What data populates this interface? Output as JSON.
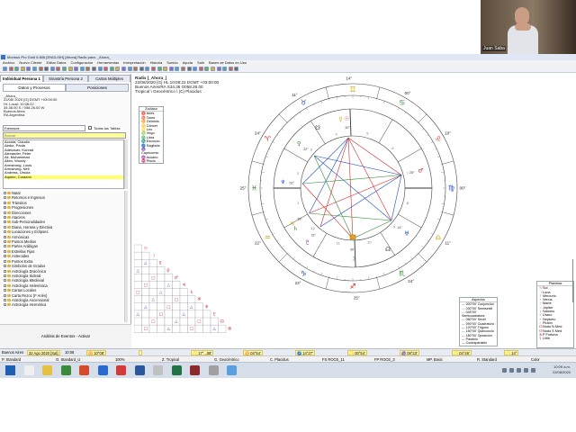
{
  "window": {
    "title": "Morinus Pro Gold 6.806 [ENGLISH] [Ahora] Radix para: _Ahora_"
  },
  "menu": [
    "Archivo",
    "Nuevo Cliente",
    "Editar Datos",
    "Configuración",
    "Herramientas",
    "Interpretación",
    "Historia",
    "Sonido",
    "Ayuda",
    "Salir",
    "Bases de Datos en Uso"
  ],
  "meeting": {
    "participant_name": "Juan Saba"
  },
  "left_panel": {
    "tabs_top": [
      "Individual Persona 1",
      "Sinastría Persona 2",
      "Cartas Múltiples"
    ],
    "tabs_sub": [
      "Datos y Procesos",
      "Posiciones"
    ],
    "person": {
      "line1": "_Ahora_",
      "line2": "22/08/ 2020 [G]  DGMT +03:00:00",
      "line3": "Hr. Local: 10:08:22",
      "line4": "34.36.00 S / 058.26.00 W",
      "line5": "Buenos Aires",
      "line6": "RA Argentina"
    },
    "file_select": "Famosos",
    "all_charts_label": "Todas las Tablas",
    "search_placeholder": "Buscar",
    "names": [
      "Acosta, Claudio",
      "Abdur, Paula",
      "Adenauer, Konrad",
      "Alexander, Peter",
      "Ali, Muhammad",
      "Allen, Woody",
      "Armstrong, Louis",
      "Armstrong, Neil",
      "Andress, Ursula",
      "Aquino, Corazón"
    ],
    "tree": [
      "Natal",
      "Retornos e Ingresos",
      "Tránsitos",
      "Progresiones",
      "Direcciones",
      "Atacires",
      "Sub-Personalidades",
      "Diana, Horaria y Electiva",
      "Lunaciones y Eclipses",
      "Armónicas",
      "Puntos Medios",
      "Partes Arábigas",
      "Estrellas Fijas",
      "Asteroides",
      "Puntos Extra",
      "Símbolos de Grados",
      "Astrología Dracónica",
      "Astrología Sideral",
      "Astrología Medieval",
      "Astrología Helenística",
      "Cartas Locales",
      "Carta Rezoc (F Ariés)",
      "Astrología Ascensional",
      "Astrología Hermética"
    ],
    "events_label": "Análisis de Eventos - Activar"
  },
  "chart_header": {
    "title": "Radix [_Ahora_]",
    "line2": "22/08/2020 [G]  HL 10:08:22  DGMT +03:00:00",
    "line3": "Buenos Aires/RA   S34.36  O058.26.00",
    "line4": "Tropical \\ Geocéntrico \\ (C) Placidus"
  },
  "zodiac_list": {
    "header": "Zodíaco",
    "signs": [
      "Aries",
      "Tauro",
      "Géminis",
      "Cáncer",
      "Leo",
      "Virgo",
      "Libra",
      "Escorpio",
      "Sagitario",
      "Capricornio",
      "Acuario",
      "Piscis"
    ]
  },
  "wheel": {
    "cusp_labels": [
      "25°",
      "24°",
      "11°",
      "14°",
      "00°",
      "10°",
      "00°",
      "11°",
      "24°",
      "25°",
      "23°",
      "22°"
    ],
    "inner_labels": [
      "30°",
      "25°",
      "22°",
      "29°",
      "14°",
      "00°",
      "02°",
      "22°"
    ],
    "house_numbers": [
      "1",
      "2",
      "3",
      "4",
      "5",
      "6",
      "7",
      "8",
      "9",
      "10",
      "11",
      "12"
    ],
    "sign_glyphs": [
      "♌",
      "♋",
      "♊",
      "♉",
      "♈",
      "♓",
      "♒",
      "♑",
      "♐",
      "♏",
      "♎",
      "♍"
    ],
    "colors": {
      "fire": "#d62828",
      "earth": "#2f8a2f",
      "air": "#c8a800",
      "water": "#1f4fbf"
    }
  },
  "aspect_legend": {
    "header": "Aspectos",
    "items": [
      "000°00' Conjunción",
      "030°00' Semisextil",
      "045°00' Semicuadratura",
      "060°00' Sextil",
      "090°00' Cuadratura",
      "120°00' Trígono",
      "150°00' Quincuncio",
      "180°00' Oposición",
      "Paralelo",
      "Contraparalelo"
    ]
  },
  "planet_legend": {
    "header": "Planetas",
    "items": [
      "Sol",
      "Luna",
      "Mercurio",
      "Venus",
      "Marte",
      "Júpiter",
      "Saturno",
      "Urano",
      "Neptuno",
      "Plutón",
      "Nodo N Med",
      "Nodo S Med",
      "P Fortuna",
      "Lilith"
    ]
  },
  "status_bar": {
    "location": "Buenos Aires",
    "date": "22 Ago 2020 [Sat]",
    "time": "10:08",
    "cells": [
      "♊ 10°08'",
      "",
      "♌ 17°...08'",
      "♊ 04°54'",
      "♐ 14°27'",
      "♌ 00°54'",
      "♑ 08°23'",
      "♌ 04°46'",
      "♌ 14°"
    ],
    "row2": [
      "P. Standard",
      "O. Standard_U",
      "100%",
      "Z. Tropical",
      "G. Geocéntrico",
      "C. Placidus",
      "FS ROCE_11",
      "FP ROCE_3",
      "MP. Basic",
      "R. Standard",
      "Color"
    ]
  },
  "taskbar": {
    "time": "10:09 a.m.",
    "date": "22/08/2020"
  }
}
